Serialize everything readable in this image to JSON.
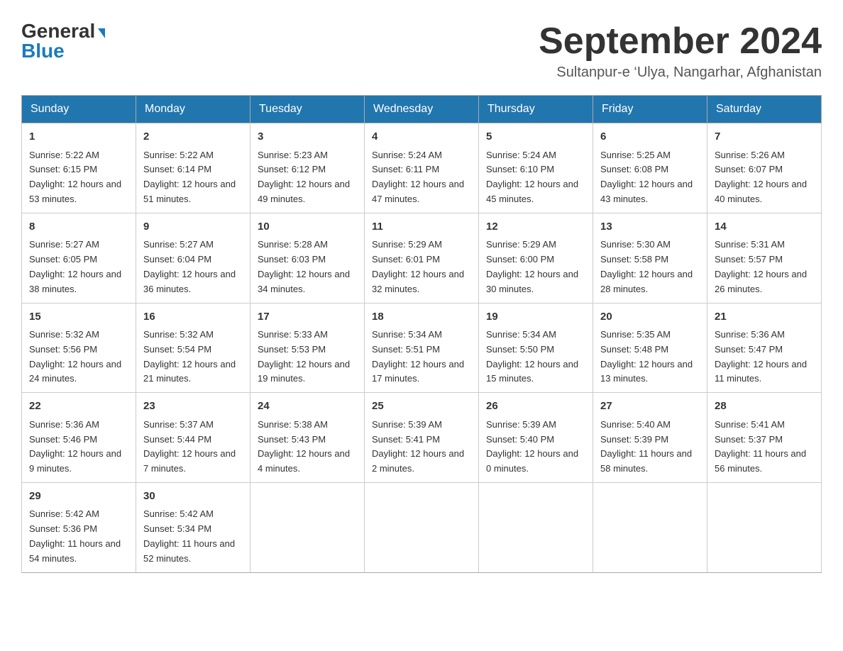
{
  "logo": {
    "general": "General",
    "blue": "Blue"
  },
  "header": {
    "month_year": "September 2024",
    "location": "Sultanpur-e ‘Ulya, Nangarhar, Afghanistan"
  },
  "days_of_week": [
    "Sunday",
    "Monday",
    "Tuesday",
    "Wednesday",
    "Thursday",
    "Friday",
    "Saturday"
  ],
  "weeks": [
    [
      {
        "day": "1",
        "sunrise": "5:22 AM",
        "sunset": "6:15 PM",
        "daylight": "12 hours and 53 minutes."
      },
      {
        "day": "2",
        "sunrise": "5:22 AM",
        "sunset": "6:14 PM",
        "daylight": "12 hours and 51 minutes."
      },
      {
        "day": "3",
        "sunrise": "5:23 AM",
        "sunset": "6:12 PM",
        "daylight": "12 hours and 49 minutes."
      },
      {
        "day": "4",
        "sunrise": "5:24 AM",
        "sunset": "6:11 PM",
        "daylight": "12 hours and 47 minutes."
      },
      {
        "day": "5",
        "sunrise": "5:24 AM",
        "sunset": "6:10 PM",
        "daylight": "12 hours and 45 minutes."
      },
      {
        "day": "6",
        "sunrise": "5:25 AM",
        "sunset": "6:08 PM",
        "daylight": "12 hours and 43 minutes."
      },
      {
        "day": "7",
        "sunrise": "5:26 AM",
        "sunset": "6:07 PM",
        "daylight": "12 hours and 40 minutes."
      }
    ],
    [
      {
        "day": "8",
        "sunrise": "5:27 AM",
        "sunset": "6:05 PM",
        "daylight": "12 hours and 38 minutes."
      },
      {
        "day": "9",
        "sunrise": "5:27 AM",
        "sunset": "6:04 PM",
        "daylight": "12 hours and 36 minutes."
      },
      {
        "day": "10",
        "sunrise": "5:28 AM",
        "sunset": "6:03 PM",
        "daylight": "12 hours and 34 minutes."
      },
      {
        "day": "11",
        "sunrise": "5:29 AM",
        "sunset": "6:01 PM",
        "daylight": "12 hours and 32 minutes."
      },
      {
        "day": "12",
        "sunrise": "5:29 AM",
        "sunset": "6:00 PM",
        "daylight": "12 hours and 30 minutes."
      },
      {
        "day": "13",
        "sunrise": "5:30 AM",
        "sunset": "5:58 PM",
        "daylight": "12 hours and 28 minutes."
      },
      {
        "day": "14",
        "sunrise": "5:31 AM",
        "sunset": "5:57 PM",
        "daylight": "12 hours and 26 minutes."
      }
    ],
    [
      {
        "day": "15",
        "sunrise": "5:32 AM",
        "sunset": "5:56 PM",
        "daylight": "12 hours and 24 minutes."
      },
      {
        "day": "16",
        "sunrise": "5:32 AM",
        "sunset": "5:54 PM",
        "daylight": "12 hours and 21 minutes."
      },
      {
        "day": "17",
        "sunrise": "5:33 AM",
        "sunset": "5:53 PM",
        "daylight": "12 hours and 19 minutes."
      },
      {
        "day": "18",
        "sunrise": "5:34 AM",
        "sunset": "5:51 PM",
        "daylight": "12 hours and 17 minutes."
      },
      {
        "day": "19",
        "sunrise": "5:34 AM",
        "sunset": "5:50 PM",
        "daylight": "12 hours and 15 minutes."
      },
      {
        "day": "20",
        "sunrise": "5:35 AM",
        "sunset": "5:48 PM",
        "daylight": "12 hours and 13 minutes."
      },
      {
        "day": "21",
        "sunrise": "5:36 AM",
        "sunset": "5:47 PM",
        "daylight": "12 hours and 11 minutes."
      }
    ],
    [
      {
        "day": "22",
        "sunrise": "5:36 AM",
        "sunset": "5:46 PM",
        "daylight": "12 hours and 9 minutes."
      },
      {
        "day": "23",
        "sunrise": "5:37 AM",
        "sunset": "5:44 PM",
        "daylight": "12 hours and 7 minutes."
      },
      {
        "day": "24",
        "sunrise": "5:38 AM",
        "sunset": "5:43 PM",
        "daylight": "12 hours and 4 minutes."
      },
      {
        "day": "25",
        "sunrise": "5:39 AM",
        "sunset": "5:41 PM",
        "daylight": "12 hours and 2 minutes."
      },
      {
        "day": "26",
        "sunrise": "5:39 AM",
        "sunset": "5:40 PM",
        "daylight": "12 hours and 0 minutes."
      },
      {
        "day": "27",
        "sunrise": "5:40 AM",
        "sunset": "5:39 PM",
        "daylight": "11 hours and 58 minutes."
      },
      {
        "day": "28",
        "sunrise": "5:41 AM",
        "sunset": "5:37 PM",
        "daylight": "11 hours and 56 minutes."
      }
    ],
    [
      {
        "day": "29",
        "sunrise": "5:42 AM",
        "sunset": "5:36 PM",
        "daylight": "11 hours and 54 minutes."
      },
      {
        "day": "30",
        "sunrise": "5:42 AM",
        "sunset": "5:34 PM",
        "daylight": "11 hours and 52 minutes."
      },
      null,
      null,
      null,
      null,
      null
    ]
  ]
}
